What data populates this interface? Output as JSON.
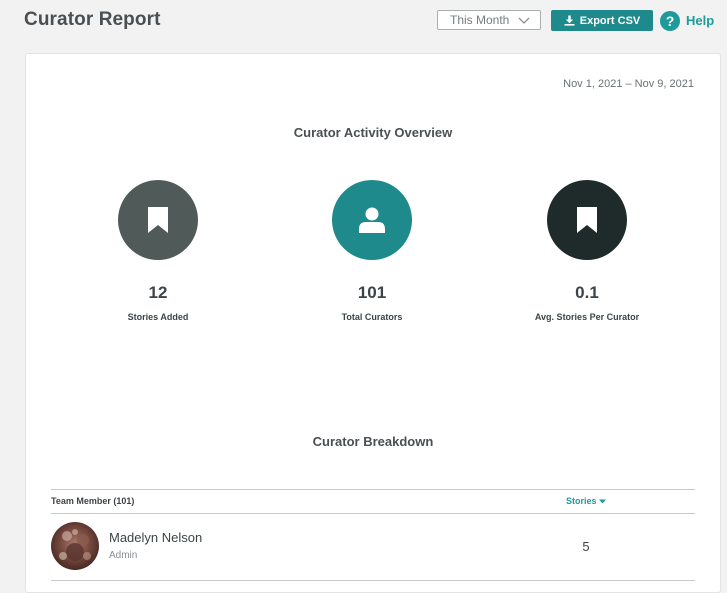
{
  "header": {
    "title": "Curator Report",
    "period_select": "This Month",
    "export_label": "Export CSV",
    "help_label": "Help"
  },
  "report": {
    "date_range": "Nov 1, 2021 – Nov 9, 2021",
    "overview_title": "Curator Activity Overview",
    "stats": [
      {
        "value": "12",
        "label": "Stories Added",
        "icon": "bookmark-icon",
        "color": "#4f5a59"
      },
      {
        "value": "101",
        "label": "Total Curators",
        "icon": "user-icon",
        "color": "#1f8a8c"
      },
      {
        "value": "0.1",
        "label": "Avg. Stories Per Curator",
        "icon": "bookmark-icon",
        "color": "#1f2b2a"
      }
    ],
    "breakdown_title": "Curator Breakdown"
  },
  "table": {
    "member_header": "Team Member (101)",
    "stories_header": "Stories",
    "rows": [
      {
        "name": "Madelyn Nelson",
        "role": "Admin",
        "stories": "5"
      }
    ]
  },
  "colors": {
    "accent": "#1f8a8c",
    "text": "#3d4447",
    "background": "#f2f2f2"
  }
}
